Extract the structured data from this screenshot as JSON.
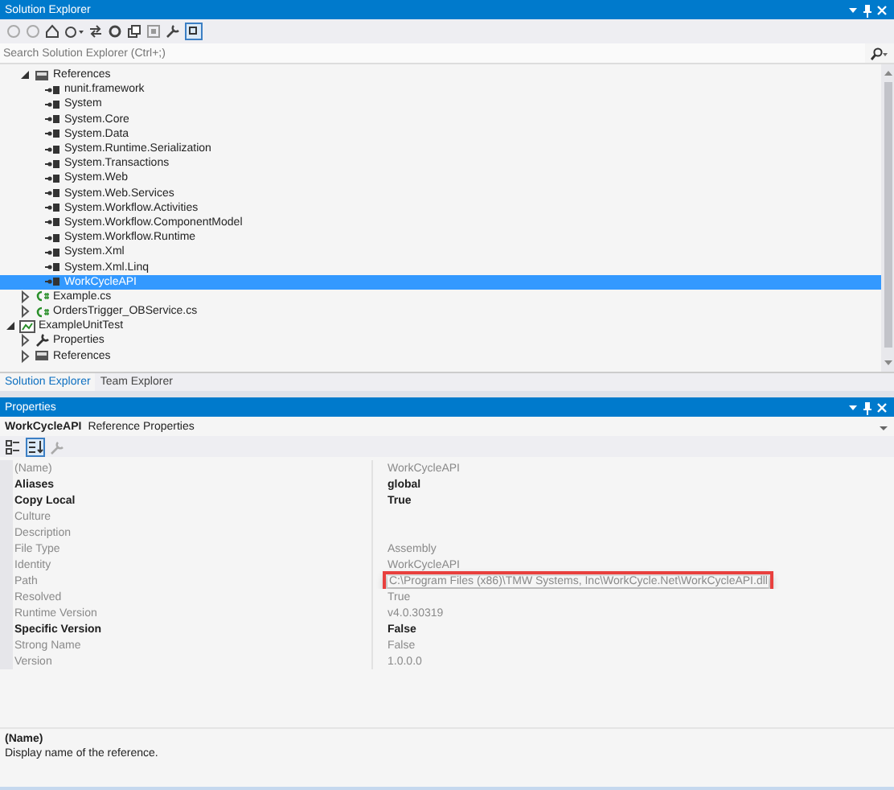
{
  "solution_explorer": {
    "title": "Solution Explorer",
    "search": {
      "placeholder": "Search Solution Explorer (Ctrl+;)"
    },
    "tree": [
      {
        "children": [
          {
            "label": "References",
            "kind": "references",
            "expanded": true,
            "selected": false,
            "children": [
              {
                "label": "nunit.framework",
                "kind": "reference",
                "selected": false
              },
              {
                "label": "System",
                "kind": "reference",
                "selected": false
              },
              {
                "label": "System.Core",
                "kind": "reference",
                "selected": false
              },
              {
                "label": "System.Data",
                "kind": "reference",
                "selected": false
              },
              {
                "label": "System.Runtime.Serialization",
                "kind": "reference",
                "selected": false
              },
              {
                "label": "System.Transactions",
                "kind": "reference",
                "selected": false
              },
              {
                "label": "System.Web",
                "kind": "reference",
                "selected": false
              },
              {
                "label": "System.Web.Services",
                "kind": "reference",
                "selected": false
              },
              {
                "label": "System.Workflow.Activities",
                "kind": "reference",
                "selected": false
              },
              {
                "label": "System.Workflow.ComponentModel",
                "kind": "reference",
                "selected": false
              },
              {
                "label": "System.Workflow.Runtime",
                "kind": "reference",
                "selected": false
              },
              {
                "label": "System.Xml",
                "kind": "reference",
                "selected": false
              },
              {
                "label": "System.Xml.Linq",
                "kind": "reference",
                "selected": false
              },
              {
                "label": "WorkCycleAPI",
                "kind": "reference",
                "selected": true
              }
            ]
          },
          {
            "label": "Example.cs",
            "kind": "csharp",
            "expanded": false,
            "selected": false
          },
          {
            "label": "OrdersTrigger_OBService.cs",
            "kind": "csharp",
            "expanded": false,
            "selected": false
          }
        ]
      },
      {
        "label": "ExampleUnitTest",
        "kind": "project",
        "expanded": true,
        "selected": false,
        "children": [
          {
            "label": "Properties",
            "kind": "properties",
            "expanded": false,
            "selected": false
          },
          {
            "label": "References",
            "kind": "references",
            "expanded": false,
            "selected": false
          }
        ]
      }
    ],
    "tabs": [
      {
        "label": "Solution Explorer",
        "selected": true
      },
      {
        "label": "Team Explorer",
        "selected": false
      }
    ]
  },
  "properties": {
    "title": "Properties",
    "object_name": "WorkCycleAPI",
    "object_type": "Reference Properties",
    "rows": [
      {
        "name": "(Name)",
        "value": "WorkCycleAPI",
        "readonly": true
      },
      {
        "name": "Aliases",
        "value": "global",
        "readonly": false
      },
      {
        "name": "Copy Local",
        "value": "True",
        "readonly": false
      },
      {
        "name": "Culture",
        "readonly": true
      },
      {
        "name": "Description",
        "readonly": true
      },
      {
        "name": "File Type",
        "value": "Assembly",
        "readonly": true
      },
      {
        "name": "Identity",
        "value": "WorkCycleAPI",
        "readonly": true
      },
      {
        "name": "Path",
        "value": "C:\\Program Files (x86)\\TMW Systems, Inc\\WorkCycle.Net\\WorkCycleAPI.dll",
        "readonly": true,
        "highlighted": true
      },
      {
        "name": "Resolved",
        "value": "True",
        "readonly": true
      },
      {
        "name": "Runtime Version",
        "value": "v4.0.30319",
        "readonly": true
      },
      {
        "name": "Specific Version",
        "value": "False",
        "readonly": false
      },
      {
        "name": "Strong Name",
        "value": "False",
        "readonly": true
      },
      {
        "name": "Version",
        "value": "1.0.0.0",
        "readonly": true
      }
    ],
    "description": {
      "heading": "(Name)",
      "text": "Display name of the reference."
    }
  }
}
